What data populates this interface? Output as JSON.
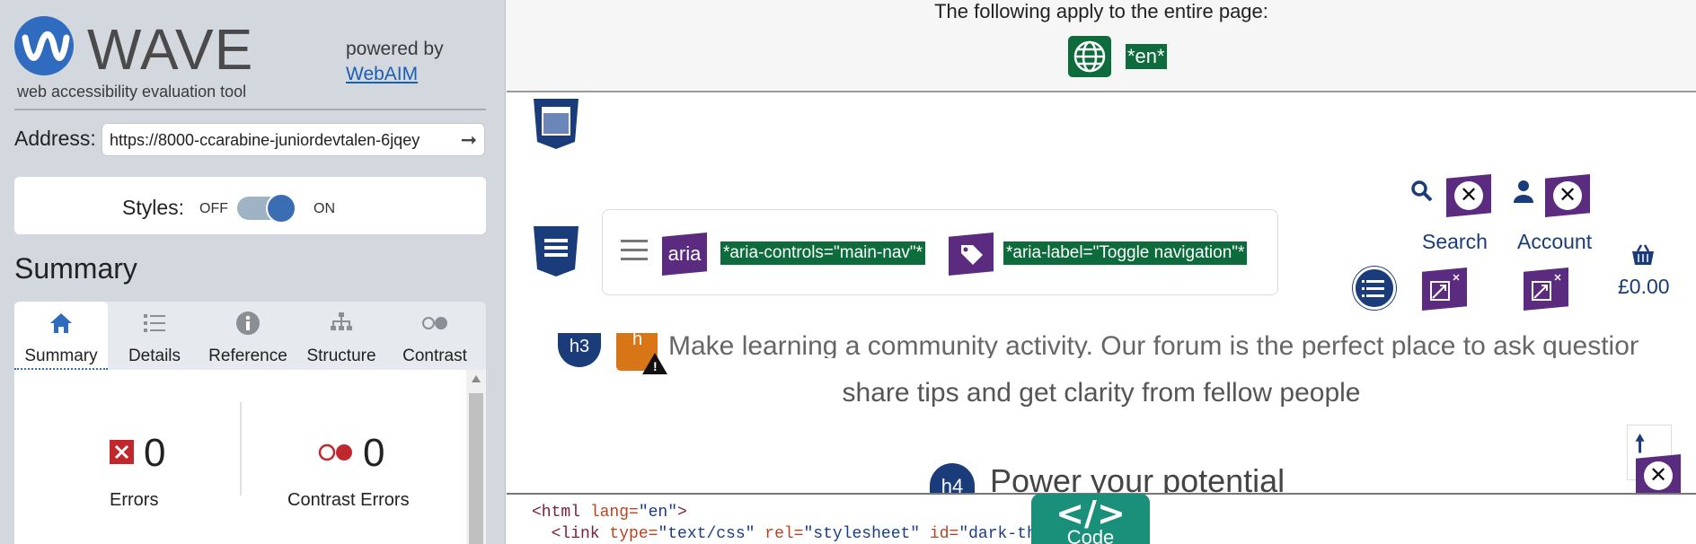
{
  "sidebar": {
    "brand": "WAVE",
    "subtitle": "web accessibility evaluation tool",
    "powered_by": "powered by",
    "powered_link": "WebAIM",
    "address_label": "Address:",
    "address_value": "https://8000-ccarabine-juniordevtalen-6jqey",
    "styles_label": "Styles:",
    "styles_off": "OFF",
    "styles_on": "ON",
    "summary_heading": "Summary",
    "tabs": [
      {
        "label": "Summary",
        "icon": "home-icon"
      },
      {
        "label": "Details",
        "icon": "list-icon"
      },
      {
        "label": "Reference",
        "icon": "info-icon"
      },
      {
        "label": "Structure",
        "icon": "sitemap-icon"
      },
      {
        "label": "Contrast",
        "icon": "contrast-icon"
      }
    ],
    "stats": [
      {
        "count": "0",
        "label": "Errors"
      },
      {
        "count": "0",
        "label": "Contrast Errors"
      }
    ]
  },
  "page": {
    "info_text": "The following apply to the entire page:",
    "lang_badge": "*en*",
    "aria_icon_text": "aria",
    "aria_controls": "*aria-controls=\"main-nav\"*",
    "aria_label": "*aria-label=\"Toggle navigation\"*",
    "search_label": "Search",
    "account_label": "Account",
    "price": "£0.00",
    "h3_badge": "h3",
    "orange_badge": "h",
    "para_line1": "Make learning a community activity. Our forum is the perfect place to ask questions,",
    "para_line2": "share tips and get clarity from fellow people",
    "h4_badge": "h4",
    "h4_text": "Power your potential"
  },
  "code": {
    "line1_tag": "<html ",
    "line1_attr": "lang=",
    "line1_val": "\"en\"",
    "line1_end": ">",
    "line2_tag": "  <link ",
    "line2_attr1": "type=",
    "line2_val1": "\"text/css\"",
    "line2_attr2": " rel=",
    "line2_val2": "\"stylesheet\"",
    "line2_attr3": " id=",
    "line2_val3": "\"dark-theme-link\"",
    "line2_end": ">",
    "button_symbol": "</>",
    "button_label": "Code"
  },
  "colors": {
    "wave_blue": "#2f6cbf",
    "aria_purple": "#5a2b7e",
    "green_badge": "#0d6b3c",
    "navy": "#1a3c7a",
    "error_red": "#c0282d",
    "code_teal": "#1a8f7a"
  }
}
